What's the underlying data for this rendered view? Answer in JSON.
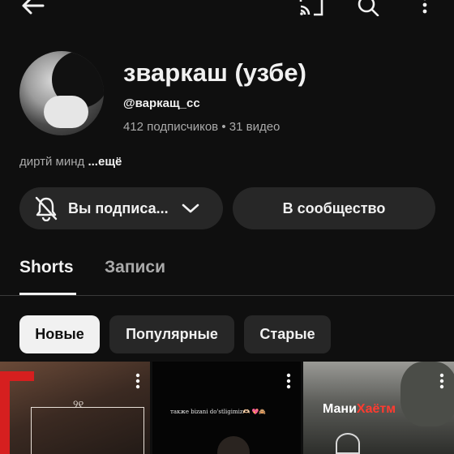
{
  "channel": {
    "title": "зваркаш (узбе)",
    "handle": "@варкащ_сс",
    "subscribers": "412 подписчиков",
    "separator": "•",
    "videos": "31 видео",
    "description": "диртй минд",
    "more_label": "...ещё"
  },
  "actions": {
    "subscribed_label": "Вы подписа...",
    "community_label": "В сообщество"
  },
  "tabs": [
    {
      "label": "Shorts",
      "selected": true
    },
    {
      "label": "Записи",
      "selected": false
    }
  ],
  "filters": [
    {
      "label": "Новые",
      "selected": true
    },
    {
      "label": "Популярные",
      "selected": false
    },
    {
      "label": "Старые",
      "selected": false
    }
  ],
  "thumbnails": [
    {
      "ornament": "୨୧"
    },
    {
      "caption": "также bizani do'stligimiz🫶🏻 💖🙈"
    },
    {
      "caption_white": "Мани",
      "caption_red": "Хаётм"
    }
  ],
  "icons": [
    "back-arrow-icon",
    "cast-icon",
    "search-icon",
    "more-vert-icon",
    "bell-icon",
    "chevron-down-icon"
  ],
  "colors": {
    "background": "#0f0f0f",
    "chip_selected": "#f1f1f1",
    "button_bg": "#272727",
    "secondary_text": "#aaaaaa"
  }
}
